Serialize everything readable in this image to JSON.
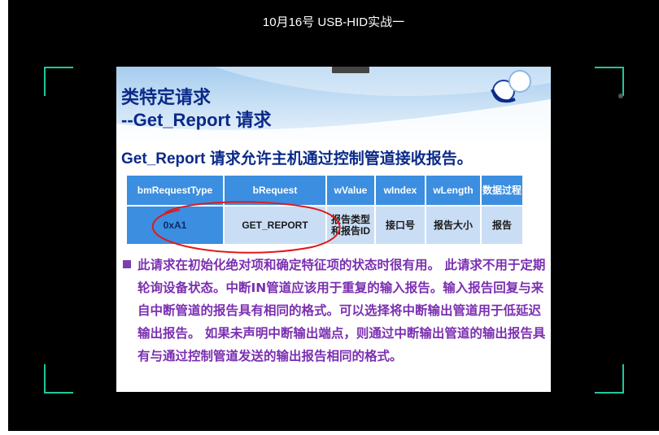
{
  "player": {
    "title": "10月16号 USB-HID实战一"
  },
  "slide": {
    "title_line1": "类特定请求",
    "title_line2": "--Get_Report 请求",
    "subtitle": "Get_Report 请求允许主机通过控制管道接收报告。",
    "table": {
      "headers": [
        "bmRequestType",
        "bRequest",
        "wValue",
        "wIndex",
        "wLength",
        "数据过程"
      ],
      "row": [
        "0xA1",
        "GET_REPORT",
        "报告类型和报告ID",
        "接口号",
        "报告大小",
        "报告"
      ]
    },
    "paragraph": "此请求在初始化绝对项和确定特征项的状态时很有用。 此请求不用于定期轮询设备状态。中断IN管道应该用于重复的输入报告。输入报告回复与来自中断管道的报告具有相同的格式。可以选择将中断输出管道用于低延迟输出报告。 如果未声明中断输出端点，则通过中断输出管道的输出报告具有与通过控制管道发送的输出报告相同的格式。"
  },
  "colors": {
    "title_blue": "#0b2a88",
    "body_purple": "#7b2fb0",
    "table_header": "#3b8ee0",
    "table_cell": "#c9def5",
    "frame_corner": "#1fc79a",
    "annotation_red": "#e0191b"
  }
}
